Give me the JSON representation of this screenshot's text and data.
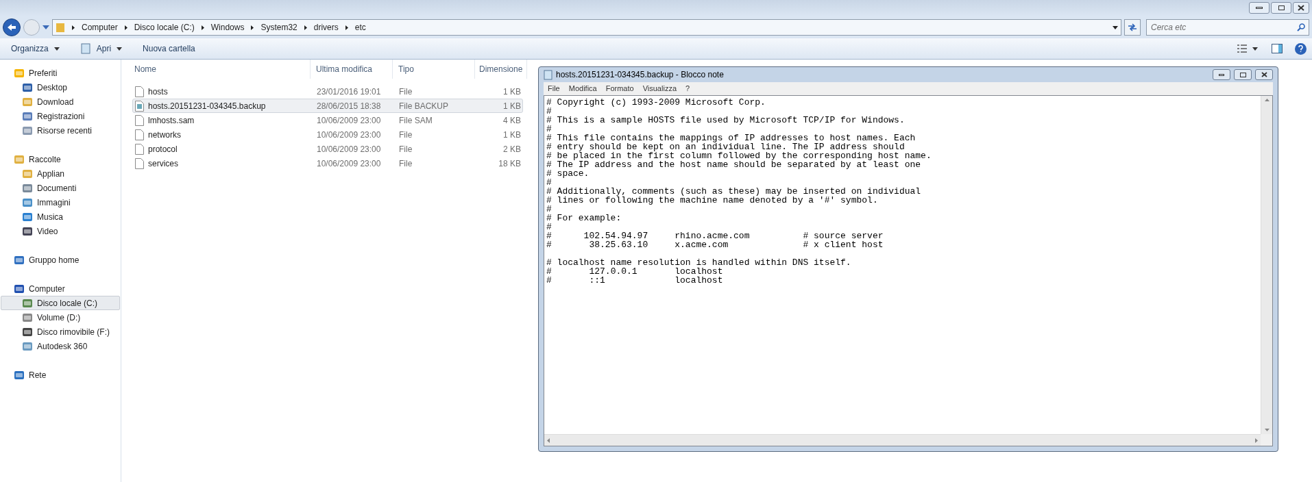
{
  "address_bar": {
    "crumbs": [
      "Computer",
      "Disco locale (C:)",
      "Windows",
      "System32",
      "drivers",
      "etc"
    ]
  },
  "search": {
    "placeholder": "Cerca etc"
  },
  "toolbar": {
    "buttons": [
      {
        "label": "Organizza",
        "dropdown": true
      },
      {
        "label": "Apri",
        "dropdown": true
      },
      {
        "label": "Nuova cartella",
        "dropdown": false
      }
    ]
  },
  "sidebar": {
    "sections": [
      {
        "label": "Preferiti",
        "selected": false,
        "children": [
          {
            "label": "Desktop",
            "selected": false
          },
          {
            "label": "Download",
            "selected": false
          },
          {
            "label": "Registrazioni",
            "selected": false
          },
          {
            "label": "Risorse recenti",
            "selected": false
          }
        ]
      },
      {
        "label": "Raccolte",
        "selected": false,
        "children": [
          {
            "label": "Applian",
            "selected": false
          },
          {
            "label": "Documenti",
            "selected": false
          },
          {
            "label": "Immagini",
            "selected": false
          },
          {
            "label": "Musica",
            "selected": false
          },
          {
            "label": "Video",
            "selected": false
          }
        ]
      },
      {
        "label": "Gruppo home",
        "selected": false
      },
      {
        "label": "Computer",
        "selected": false,
        "children": [
          {
            "label": "Disco locale (C:)",
            "selected": true
          },
          {
            "label": "Volume (D:)",
            "selected": false
          },
          {
            "label": "Disco rimovibile (F:)",
            "selected": false
          },
          {
            "label": "Autodesk 360",
            "selected": false
          }
        ]
      },
      {
        "label": "Rete",
        "selected": false
      }
    ]
  },
  "table": {
    "columns": [
      "Nome",
      "Ultima modifica",
      "Tipo",
      "Dimensione"
    ],
    "rows": [
      {
        "name": "hosts",
        "modified": "23/01/2016 19:01",
        "type": "File",
        "size": "1 KB",
        "selected": false
      },
      {
        "name": "hosts.20151231-034345.backup",
        "modified": "28/06/2015 18:38",
        "type": "File BACKUP",
        "size": "1 KB",
        "selected": true
      },
      {
        "name": "lmhosts.sam",
        "modified": "10/06/2009 23:00",
        "type": "File SAM",
        "size": "4 KB",
        "selected": false
      },
      {
        "name": "networks",
        "modified": "10/06/2009 23:00",
        "type": "File",
        "size": "1 KB",
        "selected": false
      },
      {
        "name": "protocol",
        "modified": "10/06/2009 23:00",
        "type": "File",
        "size": "2 KB",
        "selected": false
      },
      {
        "name": "services",
        "modified": "10/06/2009 23:00",
        "type": "File",
        "size": "18 KB",
        "selected": false
      }
    ]
  },
  "notepad": {
    "title": "hosts.20151231-034345.backup - Blocco note",
    "menu": [
      "File",
      "Modifica",
      "Formato",
      "Visualizza",
      "?"
    ],
    "text": "# Copyright (c) 1993-2009 Microsoft Corp.\n#\n# This is a sample HOSTS file used by Microsoft TCP/IP for Windows.\n#\n# This file contains the mappings of IP addresses to host names. Each\n# entry should be kept on an individual line. The IP address should\n# be placed in the first column followed by the corresponding host name.\n# The IP address and the host name should be separated by at least one\n# space.\n#\n# Additionally, comments (such as these) may be inserted on individual\n# lines or following the machine name denoted by a '#' symbol.\n#\n# For example:\n#\n#      102.54.94.97     rhino.acme.com          # source server\n#       38.25.63.10     x.acme.com              # x client host\n\n# localhost name resolution is handled within DNS itself.\n#\t127.0.0.1       localhost\n#\t::1             localhost"
  }
}
